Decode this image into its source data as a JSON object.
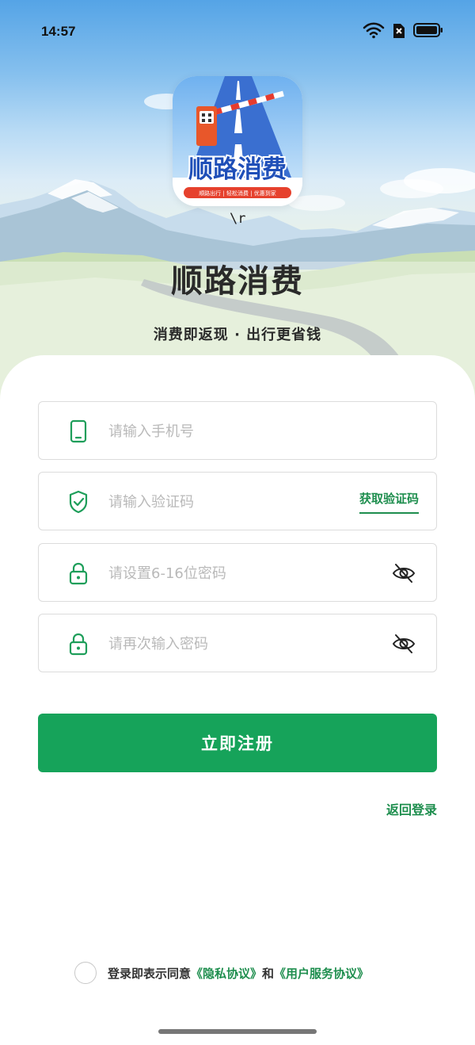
{
  "status_bar": {
    "time": "14:57",
    "icons": [
      "wifi-icon",
      "sim-blocked-icon",
      "battery-icon"
    ]
  },
  "branding": {
    "logo_wordmark": "顺路消费",
    "logo_tagline": "顺路出行 | 轻松消费 | 优惠到家",
    "stray_text": "\\r",
    "title": "顺路消费",
    "slogan": "消费即返现  ·  出行更省钱"
  },
  "form": {
    "phone": {
      "placeholder": "请输入手机号",
      "value": "",
      "icon": "phone-icon"
    },
    "code": {
      "placeholder": "请输入验证码",
      "value": "",
      "icon": "shield-check-icon",
      "action_label": "获取验证码"
    },
    "password": {
      "placeholder": "请设置6-16位密码",
      "value": "",
      "icon": "lock-icon",
      "toggle_icon": "eye-off-icon"
    },
    "confirm_password": {
      "placeholder": "请再次输入密码",
      "value": "",
      "icon": "lock-icon",
      "toggle_icon": "eye-off-icon"
    },
    "submit_label": "立即注册",
    "back_login_label": "返回登录"
  },
  "agreement": {
    "checked": false,
    "prefix": "登录即表示同意",
    "privacy_link": "《隐私协议》",
    "connector": "和",
    "service_link": "《用户服务协议》"
  },
  "colors": {
    "primary": "#16a35a",
    "link": "#1e8e4e",
    "placeholder": "#b9b9b9",
    "border": "#dcdcdc"
  }
}
